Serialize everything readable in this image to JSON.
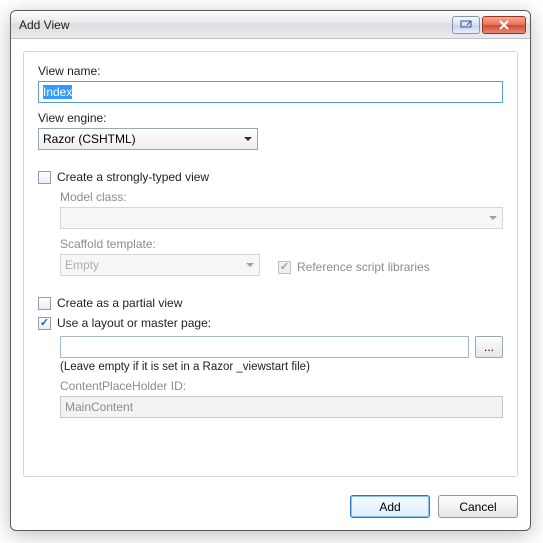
{
  "title": "Add View",
  "viewName": {
    "label": "View name:",
    "value": "Index"
  },
  "viewEngine": {
    "label": "View engine:",
    "value": "Razor (CSHTML)"
  },
  "stronglyTyped": {
    "label": "Create a strongly-typed view",
    "checked": false,
    "modelClass": {
      "label": "Model class:",
      "value": ""
    },
    "scaffold": {
      "label": "Scaffold template:",
      "value": "Empty"
    },
    "refScripts": {
      "label": "Reference script libraries",
      "checked": true
    }
  },
  "partial": {
    "label": "Create as a partial view",
    "checked": false
  },
  "layout": {
    "label": "Use a layout or master page:",
    "checked": true,
    "path": "",
    "browse": "...",
    "hint": "(Leave empty if it is set in a Razor _viewstart file)",
    "cph": {
      "label": "ContentPlaceHolder ID:",
      "value": "MainContent"
    }
  },
  "buttons": {
    "add": "Add",
    "cancel": "Cancel"
  }
}
